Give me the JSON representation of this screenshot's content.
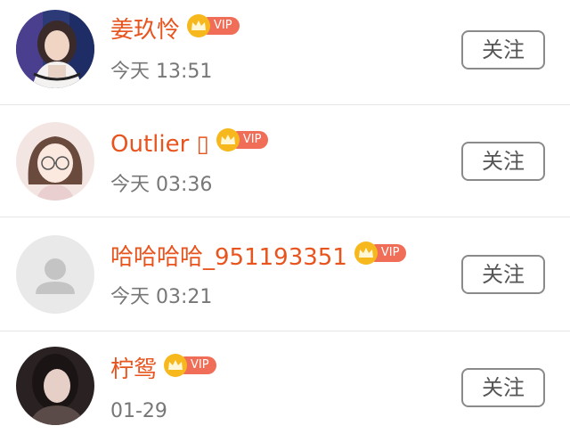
{
  "users": [
    {
      "name": "姜玖怜",
      "vip": "VIP",
      "time": "今天 13:51",
      "follow_label": "关注",
      "avatar_icon": "avatar-photo-icon"
    },
    {
      "name": "Outlier ▯",
      "vip": "VIP",
      "time": "今天 03:36",
      "follow_label": "关注",
      "avatar_icon": "avatar-illustration-icon"
    },
    {
      "name": "哈哈哈哈_951193351",
      "vip": "VIP",
      "time": "今天 03:21",
      "follow_label": "关注",
      "avatar_icon": "default-avatar-icon"
    },
    {
      "name": "柠鸳",
      "vip": "VIP",
      "time": "01-29",
      "follow_label": "关注",
      "avatar_icon": "avatar-photo-icon"
    }
  ],
  "colors": {
    "name": "#e8541e",
    "time": "#777777",
    "vip_badge": "#f06d57",
    "crown": "#f6b81c",
    "button_border": "#8a8a8a"
  }
}
